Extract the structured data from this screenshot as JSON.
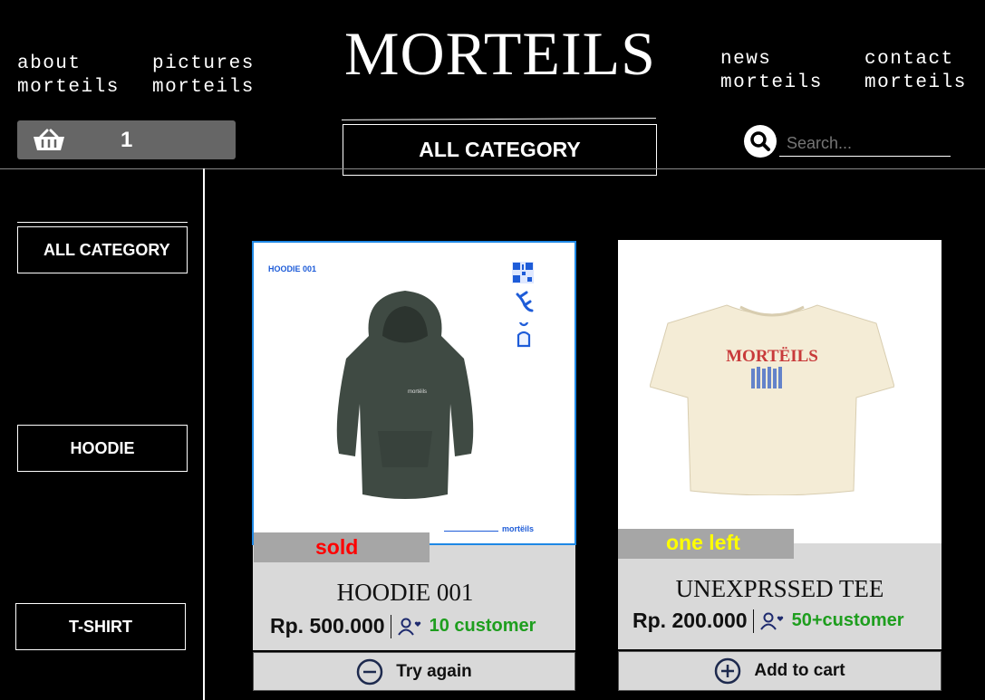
{
  "header": {
    "nav_left": [
      {
        "line1": "about",
        "line2": "morteils"
      },
      {
        "line1": "pictures",
        "line2": "morteils"
      }
    ],
    "brand": "MORTEILS",
    "nav_right": [
      {
        "line1": "news",
        "line2": "morteils"
      },
      {
        "line1": "contact",
        "line2": "morteils"
      }
    ]
  },
  "toolbar": {
    "cart_count": "1",
    "category_label": "ALL CATEGORY",
    "search_placeholder": "Search..."
  },
  "sidebar": {
    "items": [
      {
        "label": "ALL CATEGORY"
      },
      {
        "label": "HOODIE"
      },
      {
        "label": "T-SHIRT"
      }
    ]
  },
  "products": [
    {
      "image_caption": "HOODIE 001",
      "image_footer": "mortëils",
      "status_badge": "sold",
      "name": "HOODIE 001",
      "price": "Rp. 500.000",
      "customers": "10 customer",
      "action_label": "Try again",
      "action_icon": "minus-circle-icon",
      "status_color": "#ff0000"
    },
    {
      "shirt_print": "MORTËILS",
      "status_badge": "one left",
      "name": "UNEXPRSSED TEE",
      "price": "Rp. 200.000",
      "customers": "50+customer",
      "action_label": "Add to cart",
      "action_icon": "plus-circle-icon",
      "status_color": "#ffff00"
    }
  ],
  "colors": {
    "background": "#000000",
    "card": "#d9d9d9",
    "customer_text": "#1e9e1e",
    "selected_outline": "#1e88e5"
  }
}
